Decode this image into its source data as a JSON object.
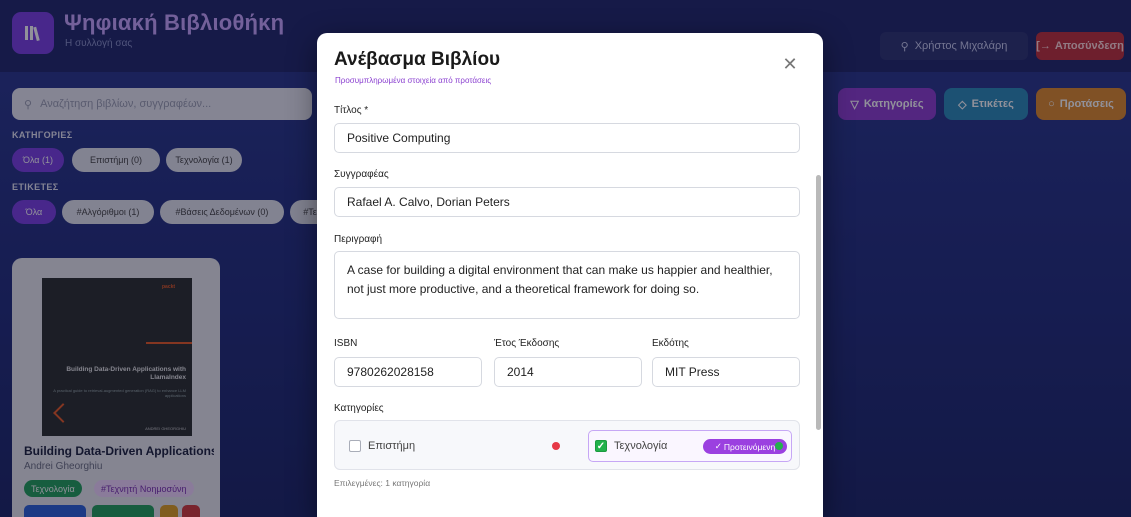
{
  "app": {
    "title": "Ψηφιακή Βιβλιοθήκη",
    "subtitle": "Η συλλογή σας",
    "user_name": "Χρήστος Μιχαλάρη",
    "logout_label": "Αποσύνδεση"
  },
  "search": {
    "placeholder": "Αναζήτηση βιβλίων, συγγραφέων..."
  },
  "filters": {
    "categories_label": "ΚΑΤΗΓΟΡΙΕΣ",
    "categories": [
      "Όλα (1)",
      "Επιστήμη (0)",
      "Τεχνολογία (1)"
    ],
    "tags_label": "ΕΤΙΚΕΤΕΣ",
    "tags": [
      "Όλα",
      "#Αλγόριθμοι (1)",
      "#Βάσεις Δεδομένων (0)",
      "#Τε"
    ],
    "buttons": {
      "categories": "Κατηγορίες",
      "tags": "Ετικέτες",
      "suggestions": "Προτάσεις"
    }
  },
  "book_card": {
    "cover_publisher": "packt",
    "cover_title": "Building Data-Driven Applications with LlamaIndex",
    "cover_subtitle": "A practical guide to retrieval-augmented generation (RAG) to enhance LLM applications",
    "cover_author": "ANDREI GHEORGHIU",
    "title": "Building Data-Driven Applications ...",
    "author": "Andrei Gheorghiu",
    "tags": [
      "Τεχνολογία",
      "#Τεχνητή Νοημοσύνη"
    ]
  },
  "modal": {
    "title": "Ανέβασμα Βιβλίου",
    "subtitle": "Προσυμπληρωμένα στοιχεία από προτάσεις",
    "fields": {
      "title_label": "Τίτλος *",
      "title_value": "Positive Computing",
      "author_label": "Συγγραφέας",
      "author_value": "Rafael A. Calvo, Dorian Peters",
      "description_label": "Περιγραφή",
      "description_value": "A case for building a digital environment that can make us happier and healthier, not just more productive, and a theoretical framework for doing so.",
      "isbn_label": "ISBN",
      "isbn_value": "9780262028158",
      "year_label": "Έτος Έκδοσης",
      "year_value": "2014",
      "publisher_label": "Εκδότης",
      "publisher_value": "MIT Press"
    },
    "categories_label": "Κατηγορίες",
    "categories": [
      {
        "label": "Επιστήμη",
        "checked": false
      },
      {
        "label": "Τεχνολογία",
        "checked": true,
        "badge": "Προτεινόμενη"
      }
    ],
    "selected_count": "Επιλεγμένες: 1 κατηγορία"
  },
  "colors": {
    "accent": "#7b3fe4",
    "danger": "#c0303a",
    "green": "#22b14c",
    "red_dot": "#e63946"
  }
}
